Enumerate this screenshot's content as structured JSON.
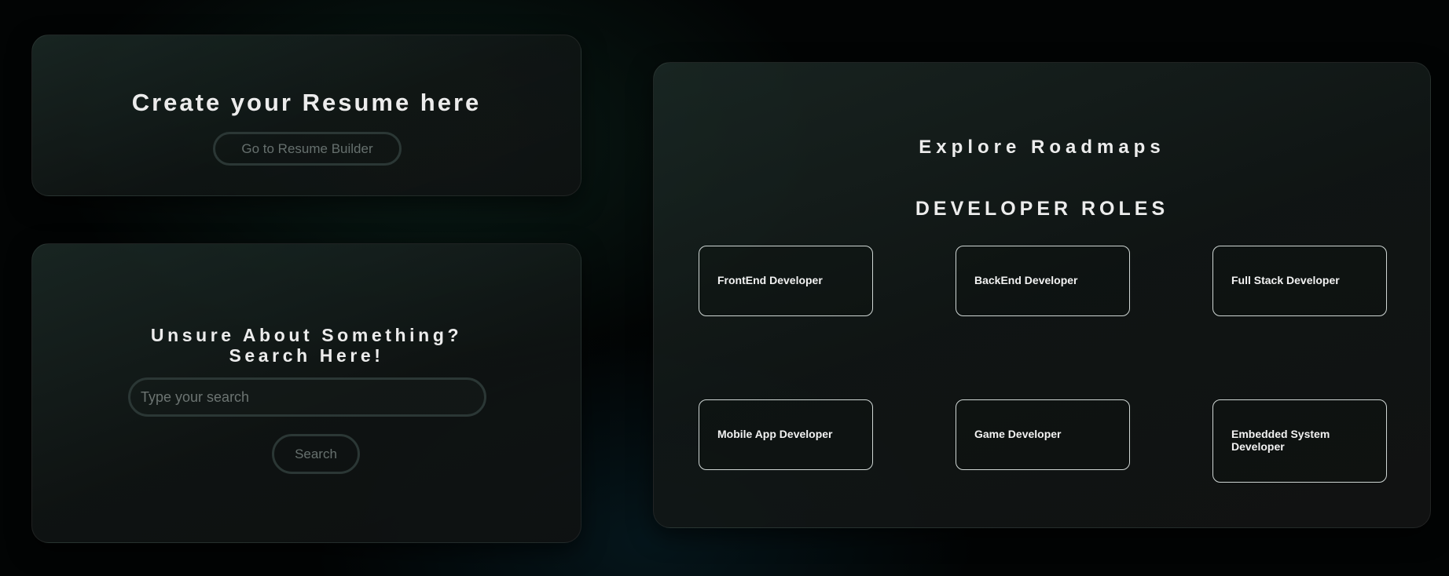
{
  "resume": {
    "title": "Create your Resume here",
    "button_label": "Go to Resume Builder"
  },
  "search": {
    "title_line1": "Unsure About Something?",
    "title_line2": "Search Here!",
    "placeholder": "Type your search",
    "value": "",
    "button_label": "Search"
  },
  "roadmaps": {
    "title": "Explore Roadmaps",
    "section_heading": "DEVELOPER ROLES",
    "roles": [
      {
        "label": "FrontEnd Developer"
      },
      {
        "label": "BackEnd Developer"
      },
      {
        "label": "Full Stack Developer"
      },
      {
        "label": "Mobile App Developer"
      },
      {
        "label": "Game Developer"
      },
      {
        "label": "Embedded System Developer"
      }
    ]
  },
  "colors": {
    "background": "#020404",
    "card_tint": "#1e2e2a",
    "text": "#ececec",
    "muted_button_text": "#66706e",
    "button_border": "#2b3735",
    "role_card_border": "#cfd6d4"
  }
}
